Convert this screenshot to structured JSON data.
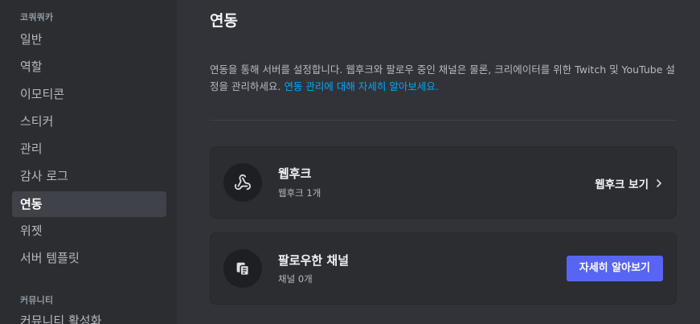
{
  "sidebar": {
    "server_section": "코쿼쿼카",
    "items": [
      {
        "label": "일반"
      },
      {
        "label": "역할"
      },
      {
        "label": "이모티콘"
      },
      {
        "label": "스티커"
      },
      {
        "label": "관리"
      },
      {
        "label": "감사 로그"
      },
      {
        "label": "연동",
        "active": true
      },
      {
        "label": "위젯"
      },
      {
        "label": "서버 템플릿"
      }
    ],
    "community_section": "커뮤니티",
    "community_items": [
      {
        "label": "커뮤니티 활성화"
      }
    ]
  },
  "main": {
    "title": "연동",
    "description": "연동을 통해 서버를 설정합니다. 웹후크와 팔로우 중인 채널은 물론, 크리에이터를 위한 Twitch 및 YouTube 설정을 관리하세요.",
    "description_link": "연동 관리에 대해 자세히 알아보세요.",
    "cards": [
      {
        "icon": "webhook-icon",
        "title": "웹후크",
        "subtitle": "웹후크 1개",
        "action_label": "웹후크 보기"
      },
      {
        "icon": "followed-channel-icon",
        "title": "팔로우한 채널",
        "subtitle": "채널 0개",
        "action_label": "자세히 알아보기"
      }
    ]
  },
  "colors": {
    "sidebar_bg": "#2b2d31",
    "main_bg": "#313338",
    "active_item_bg": "#404249",
    "card_bg": "#2b2d31",
    "icon_circle_bg": "#1e1f22",
    "link": "#00a8fc",
    "brand_button": "#5865f2"
  }
}
